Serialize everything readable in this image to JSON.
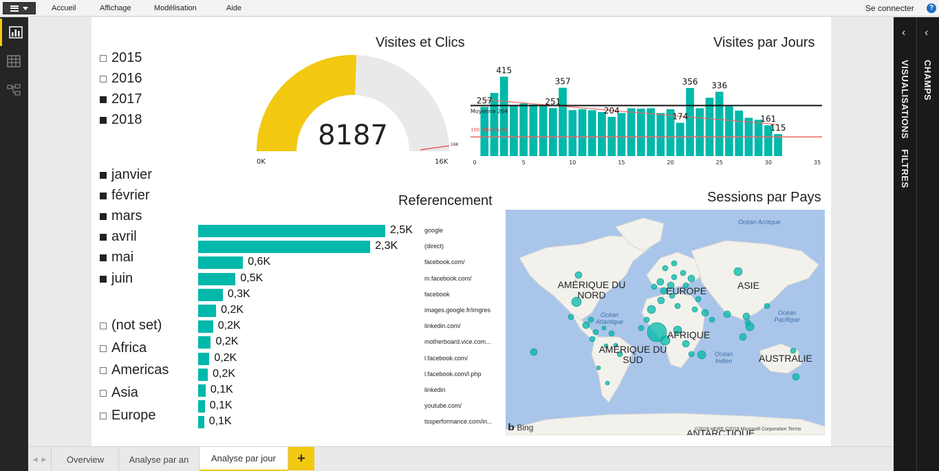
{
  "ribbon": {
    "menu": [
      "Accueil",
      "Affichage",
      "Modélisation",
      "Aide"
    ],
    "signin": "Se connecter",
    "help": "?"
  },
  "slicers": {
    "years": [
      {
        "label": "2015",
        "selected": false
      },
      {
        "label": "2016",
        "selected": false
      },
      {
        "label": "2017",
        "selected": true
      },
      {
        "label": "2018",
        "selected": true
      }
    ],
    "months": [
      {
        "label": "janvier",
        "selected": true
      },
      {
        "label": "février",
        "selected": true
      },
      {
        "label": "mars",
        "selected": true
      },
      {
        "label": "avril",
        "selected": true
      },
      {
        "label": "mai",
        "selected": true
      },
      {
        "label": "juin",
        "selected": true
      }
    ],
    "continents": [
      {
        "label": "(not set)",
        "selected": false
      },
      {
        "label": "Africa",
        "selected": false
      },
      {
        "label": "Americas",
        "selected": false
      },
      {
        "label": "Asia",
        "selected": false
      },
      {
        "label": "Europe",
        "selected": false
      }
    ]
  },
  "gauge": {
    "title": "Visites et Clics",
    "value_label": "8187",
    "value": 8187,
    "min_label": "0K",
    "max_label": "16K",
    "target_label": "16K",
    "min": 0,
    "max": 16000,
    "fill_color": "#f2c811",
    "track_color": "#e9e9e9"
  },
  "daily": {
    "title": "Visites par Jours",
    "avg_label": "Moyenne 264",
    "min_line_label": "100 (Minimum)",
    "bar_color": "#01b8aa",
    "chart_data": {
      "type": "bar",
      "x": [
        1,
        2,
        3,
        4,
        5,
        6,
        7,
        8,
        9,
        10,
        11,
        12,
        13,
        14,
        15,
        16,
        17,
        18,
        19,
        20,
        21,
        22,
        23,
        24,
        25,
        26,
        27,
        28,
        29,
        30,
        31
      ],
      "values": [
        257,
        330,
        415,
        265,
        275,
        270,
        260,
        251,
        357,
        240,
        245,
        240,
        230,
        205,
        225,
        250,
        248,
        250,
        225,
        245,
        174,
        356,
        250,
        305,
        336,
        260,
        238,
        200,
        190,
        161,
        115
      ],
      "data_labels": [
        {
          "day": 1,
          "text": "257"
        },
        {
          "day": 3,
          "text": "415"
        },
        {
          "day": 8,
          "text": "251"
        },
        {
          "day": 9,
          "text": "357"
        },
        {
          "day": 14,
          "text": "204"
        },
        {
          "day": 21,
          "text": "174"
        },
        {
          "day": 22,
          "text": "356"
        },
        {
          "day": 25,
          "text": "336"
        },
        {
          "day": 30,
          "text": "161"
        },
        {
          "day": 31,
          "text": "115"
        }
      ],
      "x_ticks": [
        "0",
        "5",
        "10",
        "15",
        "20",
        "25",
        "30",
        "35"
      ],
      "xlim": [
        0,
        35
      ],
      "ylim": [
        0,
        460
      ],
      "average": 264,
      "minimum": 100,
      "trend": [
        295,
        165
      ]
    }
  },
  "referencement": {
    "title": "Referencement",
    "bar_color": "#01b8aa",
    "chart_data": {
      "type": "bar",
      "orientation": "horizontal",
      "xlim": [
        0,
        2500
      ],
      "categories": [
        "google",
        "(direct)",
        "facebook.com/",
        "m.facebook.com/",
        "facebook",
        "images.google.fr/imgres",
        "linkedin.com/",
        "motherboard.vice.com...",
        "l.facebook.com/",
        "l.facebook.com/l.php",
        "linkedin",
        "youtube.com/",
        "tssperformance.com/in..."
      ],
      "values": [
        2500,
        2300,
        600,
        500,
        330,
        240,
        200,
        170,
        150,
        130,
        100,
        90,
        80
      ],
      "value_labels": [
        "2,5K",
        "2,3K",
        "0,6K",
        "0,5K",
        "0,3K",
        "0,2K",
        "0,2K",
        "0,2K",
        "0,2K",
        "0,2K",
        "0,1K",
        "0,1K",
        "0,1K"
      ]
    }
  },
  "map": {
    "title": "Sessions par Pays",
    "labels": {
      "na": "AMÉRIQUE DU NORD",
      "sa": "AMÉRIQUE DU SUD",
      "eu": "EUROPE",
      "asia": "ASIE",
      "af": "AFRIQUE",
      "au": "AUSTRALIE",
      "an": "ANTARCTIQUE"
    },
    "oceans": {
      "arctic": "Océan Arctique",
      "atlantic": "Océan Atlantique",
      "pacific": "Océan Pacifique",
      "indian": "Océan Indien"
    },
    "bing": "Bing",
    "copyright": "©2018 HERE ©2018 Microsoft Corporation Terms"
  },
  "right_pane": {
    "visualisations": "VISUALISATIONS",
    "filtres": "FILTRES",
    "champs": "CHAMPS"
  },
  "tabs": {
    "items": [
      "Overview",
      "Analyse par an",
      "Analyse par jour"
    ],
    "active": 2,
    "add_icon": "+"
  },
  "icons": [
    "report-view-icon",
    "data-view-icon",
    "model-view-icon",
    "chevron-left-icon",
    "plus-icon",
    "file-menu-icon",
    "help-icon"
  ],
  "colors": {
    "accent": "#f2c811",
    "teal": "#01b8aa",
    "dark_rail": "#252525",
    "avg_line": "#111111",
    "min_line": "#ee4444"
  }
}
